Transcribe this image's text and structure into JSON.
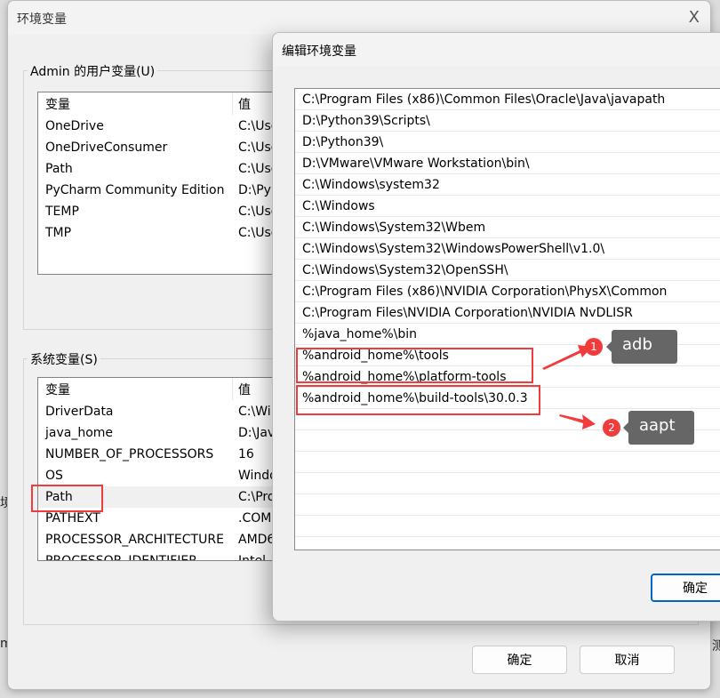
{
  "background": {
    "frag_left": "境",
    "frag_left2": "m",
    "frag_right": "测"
  },
  "main_dialog": {
    "title": "环境变量",
    "close_label": "X",
    "user_group": {
      "label": "Admin 的用户变量(U)",
      "headers": [
        "变量",
        "值"
      ],
      "rows": [
        [
          "OneDrive",
          "C:\\Use"
        ],
        [
          "OneDriveConsumer",
          "C:\\Use"
        ],
        [
          "Path",
          "C:\\Use"
        ],
        [
          "PyCharm Community Edition",
          "D:\\Py"
        ],
        [
          "TEMP",
          "C:\\Use"
        ],
        [
          "TMP",
          "C:\\Use"
        ]
      ]
    },
    "system_group": {
      "label": "系统变量(S)",
      "headers": [
        "变量",
        "值"
      ],
      "rows": [
        [
          "DriverData",
          "C:\\Wi"
        ],
        [
          "java_home",
          "D:\\Jav"
        ],
        [
          "NUMBER_OF_PROCESSORS",
          "16"
        ],
        [
          "OS",
          "Windo"
        ],
        [
          "Path",
          "C:\\Pro"
        ],
        [
          "PATHEXT",
          ".COM"
        ],
        [
          "PROCESSOR_ARCHITECTURE",
          "AMD6"
        ],
        [
          "PROCESSOR_IDENTIFIER",
          "Intel"
        ]
      ],
      "selected": "Path"
    },
    "ok_label": "确定",
    "cancel_label": "取消"
  },
  "edit_dialog": {
    "title": "编辑环境变量",
    "entries": [
      "C:\\Program Files (x86)\\Common Files\\Oracle\\Java\\javapath",
      "D:\\Python39\\Scripts\\",
      "D:\\Python39\\",
      "D:\\VMware\\VMware Workstation\\bin\\",
      "C:\\Windows\\system32",
      "C:\\Windows",
      "C:\\Windows\\System32\\Wbem",
      "C:\\Windows\\System32\\WindowsPowerShell\\v1.0\\",
      "C:\\Windows\\System32\\OpenSSH\\",
      "C:\\Program Files (x86)\\NVIDIA Corporation\\PhysX\\Common",
      "C:\\Program Files\\NVIDIA Corporation\\NVIDIA NvDLISR",
      "%java_home%\\bin",
      "%android_home%\\tools",
      "%android_home%\\platform-tools",
      "%android_home%\\build-tools\\30.0.3",
      "",
      "",
      "",
      "",
      "",
      ""
    ],
    "ok_label": "确定"
  },
  "annotations": [
    {
      "number": "1",
      "label": "adb"
    },
    {
      "number": "2",
      "label": "aapt"
    }
  ],
  "colors": {
    "highlight": "#f03c3c",
    "tip": "#666666",
    "accent": "#0067c0"
  }
}
